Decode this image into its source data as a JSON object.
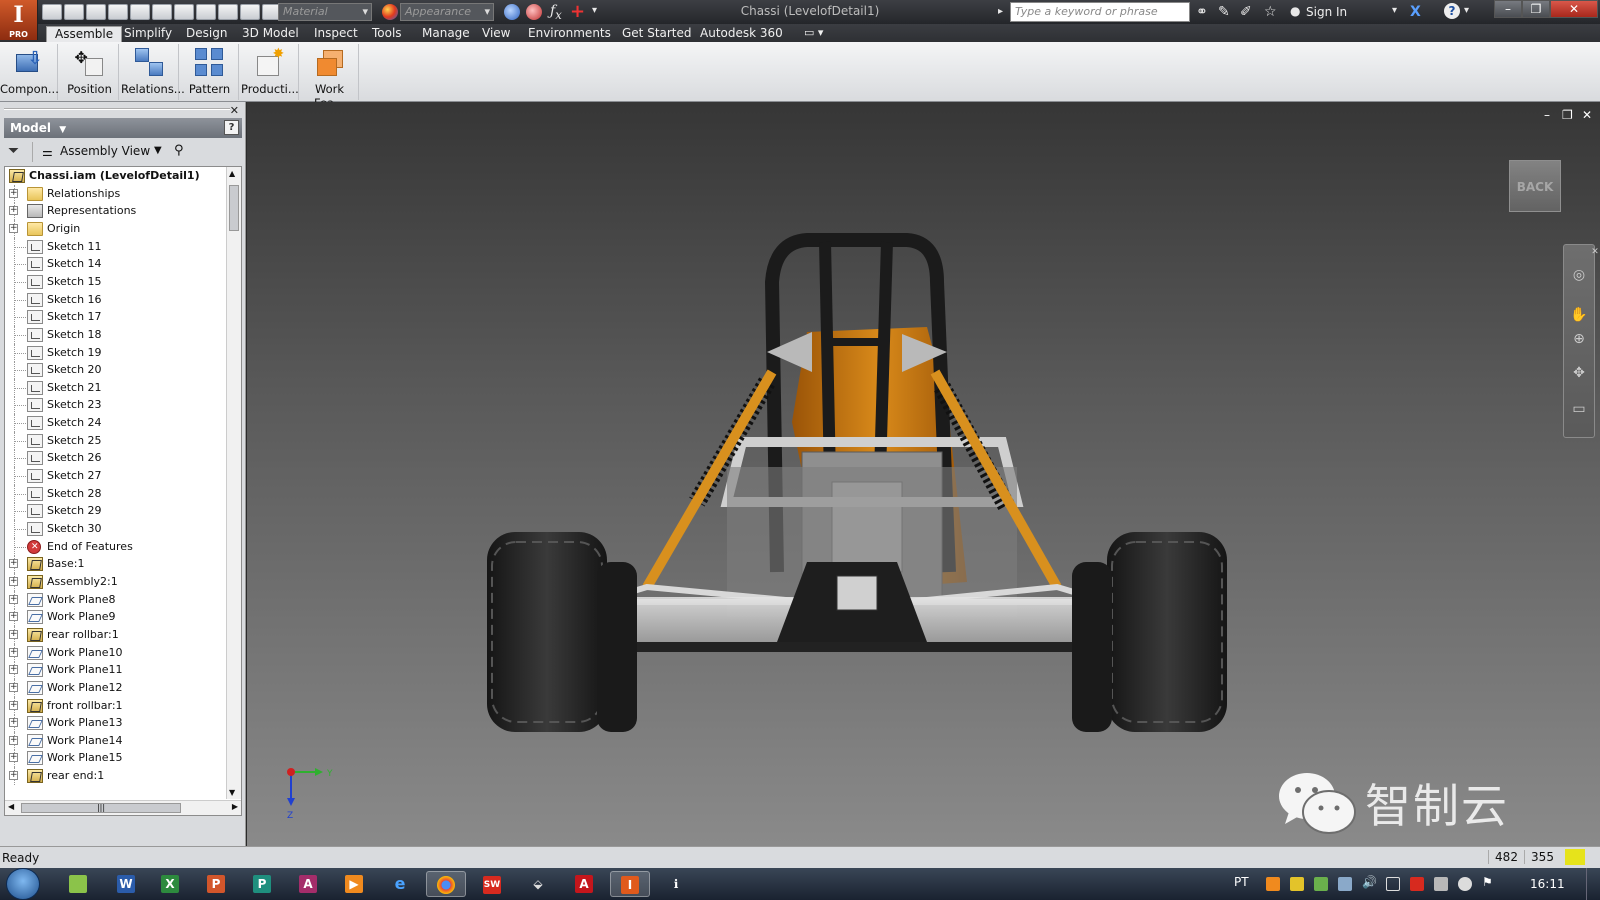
{
  "app": {
    "logo": "I",
    "edition": "PRO",
    "document_title": "Chassi (LevelofDetail1)",
    "material_placeholder": "Material",
    "appearance_placeholder": "Appearance",
    "search_placeholder": "Type a keyword or phrase",
    "sign_in": "Sign In"
  },
  "ribbon_tabs": [
    "Assemble",
    "Simplify",
    "Design",
    "3D Model",
    "Inspect",
    "Tools",
    "Manage",
    "View",
    "Environments",
    "Get Started",
    "Autodesk 360"
  ],
  "ribbon_buttons": [
    "Compon...",
    "Position",
    "Relations...",
    "Pattern",
    "Producti...",
    "Work Fea..."
  ],
  "browser": {
    "header": "Model",
    "view_mode": "Assembly View",
    "help": "?",
    "tree": [
      {
        "label": "Chassi.iam (LevelofDetail1)",
        "icon": "assembly-icon",
        "root": true
      },
      {
        "label": "Relationships",
        "icon": "folder-icon",
        "expandable": true
      },
      {
        "label": "Representations",
        "icon": "representations-icon",
        "expandable": true
      },
      {
        "label": "Origin",
        "icon": "folder-icon",
        "expandable": true
      },
      {
        "label": "Sketch 11",
        "icon": "sketch-icon"
      },
      {
        "label": "Sketch 14",
        "icon": "sketch-icon"
      },
      {
        "label": "Sketch 15",
        "icon": "sketch-icon"
      },
      {
        "label": "Sketch 16",
        "icon": "sketch-icon"
      },
      {
        "label": "Sketch 17",
        "icon": "sketch-icon"
      },
      {
        "label": "Sketch 18",
        "icon": "sketch-icon"
      },
      {
        "label": "Sketch 19",
        "icon": "sketch-icon"
      },
      {
        "label": "Sketch 20",
        "icon": "sketch-icon"
      },
      {
        "label": "Sketch 21",
        "icon": "sketch-icon"
      },
      {
        "label": "Sketch 23",
        "icon": "sketch-icon"
      },
      {
        "label": "Sketch 24",
        "icon": "sketch-icon"
      },
      {
        "label": "Sketch 25",
        "icon": "sketch-icon"
      },
      {
        "label": "Sketch 26",
        "icon": "sketch-icon"
      },
      {
        "label": "Sketch 27",
        "icon": "sketch-icon"
      },
      {
        "label": "Sketch 28",
        "icon": "sketch-icon"
      },
      {
        "label": "Sketch 29",
        "icon": "sketch-icon"
      },
      {
        "label": "Sketch 30",
        "icon": "sketch-icon"
      },
      {
        "label": "End of Features",
        "icon": "end-of-features-icon"
      },
      {
        "label": "Base:1",
        "icon": "component-icon",
        "expandable": true
      },
      {
        "label": "Assembly2:1",
        "icon": "component-icon",
        "expandable": true
      },
      {
        "label": "Work Plane8",
        "icon": "work-plane-icon",
        "expandable": true
      },
      {
        "label": "Work Plane9",
        "icon": "work-plane-icon",
        "expandable": true
      },
      {
        "label": "rear rollbar:1",
        "icon": "component-icon",
        "expandable": true
      },
      {
        "label": "Work Plane10",
        "icon": "work-plane-icon",
        "expandable": true
      },
      {
        "label": "Work Plane11",
        "icon": "work-plane-icon",
        "expandable": true
      },
      {
        "label": "Work Plane12",
        "icon": "work-plane-icon",
        "expandable": true
      },
      {
        "label": "front rollbar:1",
        "icon": "component-icon",
        "expandable": true
      },
      {
        "label": "Work Plane13",
        "icon": "work-plane-icon",
        "expandable": true
      },
      {
        "label": "Work Plane14",
        "icon": "work-plane-icon",
        "expandable": true
      },
      {
        "label": "Work Plane15",
        "icon": "work-plane-icon",
        "expandable": true
      },
      {
        "label": "rear end:1",
        "icon": "component-icon",
        "expandable": true
      }
    ]
  },
  "viewport": {
    "viewcube_label": "BACK",
    "triad_y": "Y",
    "triad_z": "Z",
    "watermark": "智制云"
  },
  "status": {
    "text": "Ready",
    "coord_x": "482",
    "coord_y": "355"
  },
  "taskbar": {
    "apps": [
      "explorer",
      "W",
      "X",
      "P",
      "P",
      "A",
      "media",
      "ie",
      "chrome",
      "solidworks",
      "app",
      "A",
      "I",
      "info"
    ],
    "language": "PT",
    "clock": "16:11"
  },
  "colors": {
    "accent_orange": "#c8760f",
    "frame_dark": "#1c1c1c",
    "viewport_top": "#363636",
    "viewport_bottom": "#8a8a8a"
  }
}
